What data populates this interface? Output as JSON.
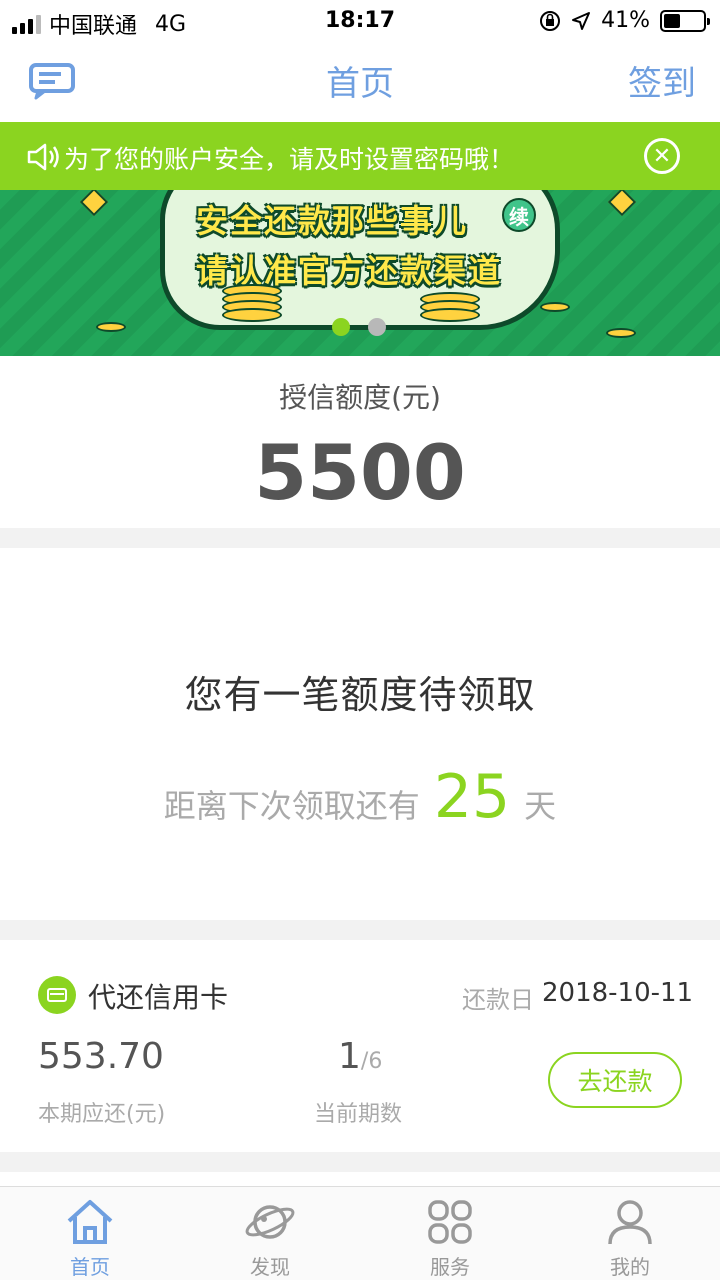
{
  "status_bar": {
    "carrier": "中国联通",
    "network": "4G",
    "time": "18:17",
    "battery": "41%",
    "battery_level": 0.41
  },
  "nav": {
    "title": "首页",
    "sign_in": "签到",
    "message_icon": "message-icon"
  },
  "notice": {
    "text": "为了您的账户安全，请及时设置密码哦！",
    "close_icon": "close-icon",
    "speaker_icon": "speaker-icon"
  },
  "banner": {
    "line1": "安全还款那些事儿",
    "badge": "续",
    "line2": "请认准官方还款渠道",
    "slides": 2,
    "active_slide": 1
  },
  "credit": {
    "label": "授信额度(元)",
    "value": "5500"
  },
  "pending": {
    "title": "您有一笔额度待领取",
    "sub_prefix": "距离下次领取还有",
    "days": "25",
    "sub_suffix": "天"
  },
  "repayment": {
    "title": "代还信用卡",
    "date_label": "还款日",
    "date": "2018-10-11",
    "amount": "553.70",
    "amount_label": "本期应还(元)",
    "period_current": "1",
    "period_total": "/6",
    "period_label": "当前期数",
    "button": "去还款"
  },
  "tabs": [
    {
      "label": "首页",
      "icon": "home-icon",
      "active": true
    },
    {
      "label": "发现",
      "icon": "planet-icon",
      "active": false
    },
    {
      "label": "服务",
      "icon": "grid-icon",
      "active": false
    },
    {
      "label": "我的",
      "icon": "user-icon",
      "active": false
    }
  ],
  "colors": {
    "accent": "#8bd420",
    "nav_blue": "#6f9fe0",
    "banner_green": "#22a65a"
  }
}
